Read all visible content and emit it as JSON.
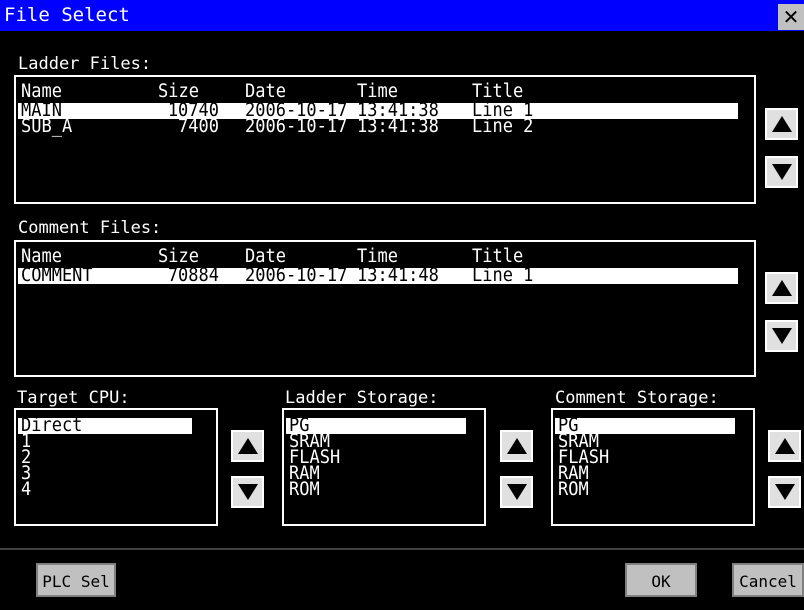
{
  "window": {
    "title": "File Select",
    "close_glyph": "✕"
  },
  "ladder": {
    "label": "Ladder Files:",
    "headers": [
      "Name",
      "Size",
      "Date",
      "Time",
      "Title"
    ],
    "rows": [
      [
        "MAIN",
        "10740",
        "2006-10-17",
        "13:41:38",
        "Line 1"
      ],
      [
        "SUB_A",
        "7400",
        "2006-10-17",
        "13:41:38",
        "Line 2"
      ]
    ],
    "selected_index": 0
  },
  "comment": {
    "label": "Comment Files:",
    "headers": [
      "Name",
      "Size",
      "Date",
      "Time",
      "Title"
    ],
    "rows": [
      [
        "COMMENT",
        "70884",
        "2006-10-17",
        "13:41:48",
        "Line 1"
      ]
    ],
    "selected_index": 0
  },
  "target_cpu": {
    "label": "Target CPU:",
    "items": [
      "Direct",
      "1",
      "2",
      "3",
      "4"
    ],
    "selected_index": 0
  },
  "ladder_storage": {
    "label": "Ladder Storage:",
    "items": [
      "PG",
      "SRAM",
      "FLASH",
      "RAM",
      "ROM"
    ],
    "selected_index": 0
  },
  "comment_storage": {
    "label": "Comment Storage:",
    "items": [
      "PG",
      "SRAM",
      "FLASH",
      "RAM",
      "ROM"
    ],
    "selected_index": 0
  },
  "buttons": {
    "plc_sel": "PLC Sel",
    "ok": "OK",
    "cancel": "Cancel"
  },
  "icons": {
    "scroll_up": "triangle-up-icon",
    "scroll_down": "triangle-down-icon",
    "close": "close-icon"
  },
  "colors": {
    "titlebar": "#0000ff",
    "background": "#000000",
    "selection": "#ffffff",
    "button": "#c0c0c0"
  }
}
